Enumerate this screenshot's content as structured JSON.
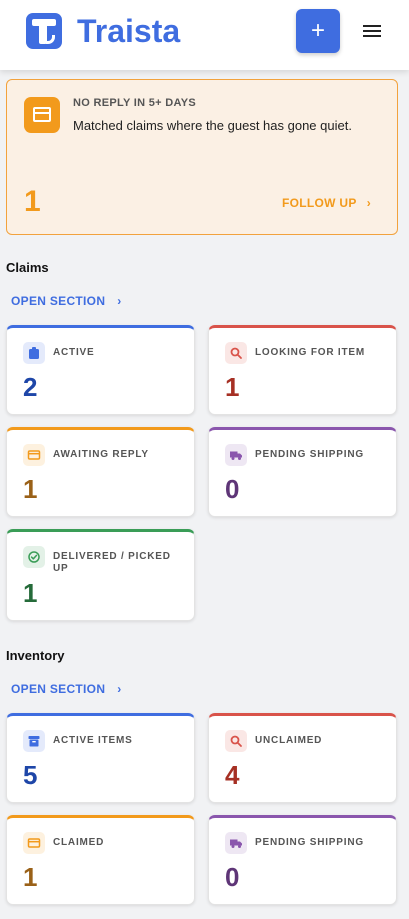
{
  "header": {
    "brand": "Traista",
    "add_label": "+",
    "icons": [
      "traista-logo-icon",
      "plus-icon",
      "hamburger-menu-icon"
    ]
  },
  "alert": {
    "title": "NO REPLY IN 5+ DAYS",
    "description": "Matched claims where the guest has gone quiet.",
    "count": "1",
    "action": "FOLLOW UP",
    "chevron": "›",
    "color": "#f29a1c"
  },
  "claims": {
    "title": "Claims",
    "open_label": "OPEN SECTION",
    "chevron": "›",
    "cards": [
      {
        "label": "ACTIVE",
        "value": "2",
        "color": "#3f6de0",
        "value_color": "#1e46a8",
        "icon": "clipboard-icon"
      },
      {
        "label": "LOOKING FOR ITEM",
        "value": "1",
        "color": "#d9534a",
        "value_color": "#a63024",
        "icon": "search-icon"
      },
      {
        "label": "AWAITING REPLY",
        "value": "1",
        "color": "#f29a1c",
        "value_color": "#9a6118",
        "icon": "card-icon"
      },
      {
        "label": "PENDING SHIPPING",
        "value": "0",
        "color": "#8a56ad",
        "value_color": "#5e3577",
        "icon": "truck-icon"
      },
      {
        "label": "DELIVERED / PICKED UP",
        "value": "1",
        "color": "#3a9d57",
        "value_color": "#256b3a",
        "icon": "check-circle-icon"
      }
    ]
  },
  "inventory": {
    "title": "Inventory",
    "open_label": "OPEN SECTION",
    "chevron": "›",
    "cards": [
      {
        "label": "ACTIVE ITEMS",
        "value": "5",
        "color": "#3f6de0",
        "value_color": "#1e46a8",
        "icon": "archive-icon"
      },
      {
        "label": "UNCLAIMED",
        "value": "4",
        "color": "#d9534a",
        "value_color": "#a63024",
        "icon": "search-icon"
      },
      {
        "label": "CLAIMED",
        "value": "1",
        "color": "#f29a1c",
        "value_color": "#9a6118",
        "icon": "card-icon"
      },
      {
        "label": "PENDING SHIPPING",
        "value": "0",
        "color": "#8a56ad",
        "value_color": "#5e3577",
        "icon": "truck-icon"
      }
    ]
  }
}
